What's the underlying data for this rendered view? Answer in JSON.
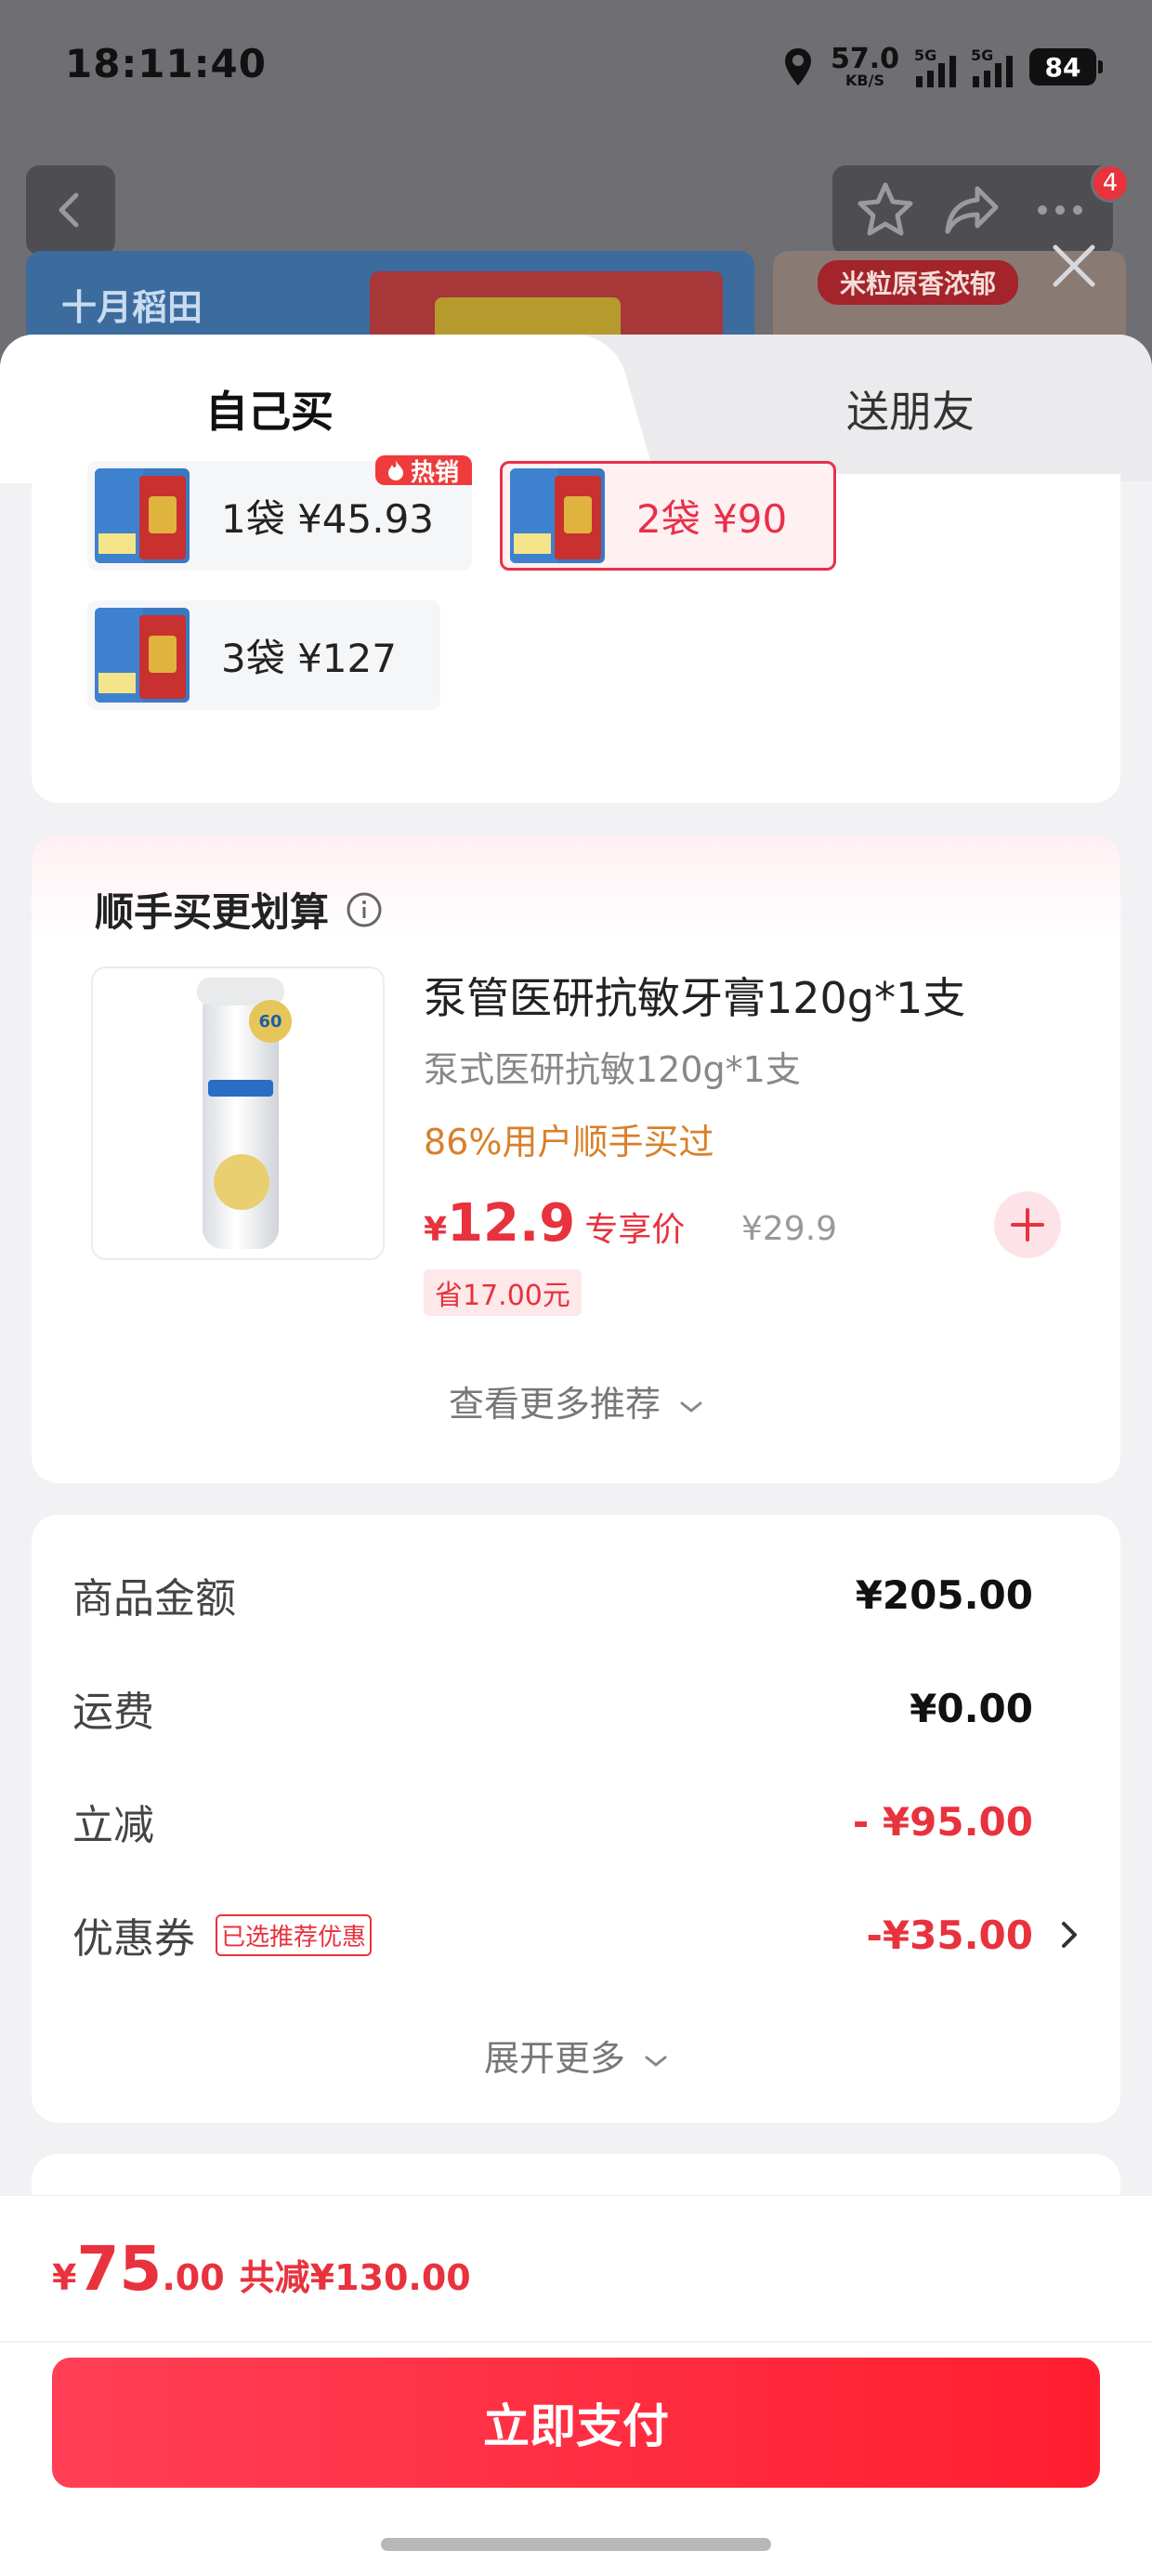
{
  "status": {
    "time": "18:11:40",
    "speed_value": "57.0",
    "speed_unit": "KB/S",
    "sim1": "5G",
    "sim2": "5G",
    "battery": "84"
  },
  "nav": {
    "badge_count": "4"
  },
  "banner": {
    "brand": "十月稻田",
    "tagline": "米粒原香浓郁"
  },
  "tabs": {
    "self": "自己买",
    "friend": "送朋友"
  },
  "variants": [
    {
      "label": "1袋  ¥45.93",
      "badge": "热销",
      "selected": false
    },
    {
      "label": "2袋  ¥90",
      "selected": true
    },
    {
      "label": "3袋  ¥127",
      "selected": false
    }
  ],
  "addon": {
    "title": "顺手买更划算",
    "product_name": "泵管医研抗敏牙膏120g*1支",
    "product_spec": "泵式医研抗敏120g*1支",
    "stat": "86%用户顺手买过",
    "currency": "¥",
    "price": "12.9",
    "price_label": "专享价",
    "original_price": "¥29.9",
    "save": "省17.00元",
    "tube_badge": "60",
    "more": "查看更多推荐"
  },
  "summary": {
    "rows": [
      {
        "label": "商品金额",
        "value": "¥205.00"
      },
      {
        "label": "运费",
        "value": "¥0.00"
      },
      {
        "label": "立减",
        "value": "- ¥95.00"
      },
      {
        "label": "优惠券",
        "chip": "已选推荐优惠",
        "value": "-¥35.00"
      }
    ],
    "expand": "展开更多"
  },
  "bottom": {
    "currency": "¥",
    "total_int": "75",
    "total_dec": ".00",
    "saved": "共减¥130.00",
    "pay": "立即支付"
  },
  "colors": {
    "accent": "#e8323d",
    "pay_start": "#ff3f55",
    "pay_end": "#ff1e2f",
    "stat": "#d8802a"
  }
}
